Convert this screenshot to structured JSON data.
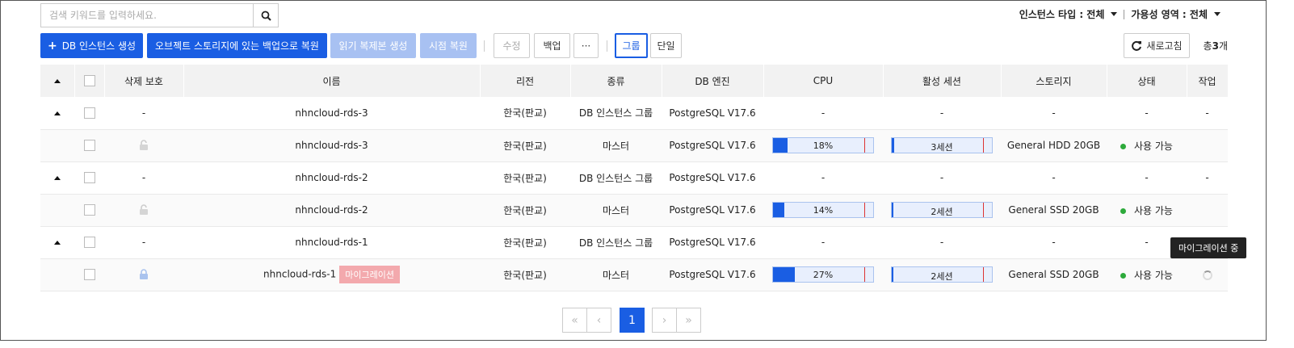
{
  "search": {
    "placeholder": "검색 키워드를 입력하세요."
  },
  "filters": {
    "instance_type": "인스턴스 타입 : 전체",
    "availability_zone": "가용성 영역 : 전체"
  },
  "toolbar": {
    "create_label": "DB 인스턴스 생성",
    "restore_object_label": "오브젝트 스토리지에 있는 백업으로 복원",
    "read_replica_label": "읽기 복제본 생성",
    "pitr_label": "시점 복원",
    "edit_label": "수정",
    "backup_label": "백업",
    "more_label": "···",
    "group_label": "그룹",
    "single_label": "단일",
    "refresh_label": "새로고침",
    "total_prefix": "총",
    "total_count": "3",
    "total_suffix": "개"
  },
  "table": {
    "headers": [
      "삭제 보호",
      "이름",
      "리전",
      "종류",
      "DB 엔진",
      "CPU",
      "활성 세션",
      "스토리지",
      "상태",
      "작업"
    ],
    "rows": [
      {
        "kind": "group",
        "protect": "-",
        "name": "nhncloud-rds-3",
        "region": "한국(판교)",
        "type": "DB 인스턴스 그룹",
        "engine": "PostgreSQL V17.6",
        "cpu": "-",
        "sessions": "-",
        "storage": "-",
        "status": "-",
        "action": "-"
      },
      {
        "kind": "child",
        "name": "nhncloud-rds-3",
        "region": "한국(판교)",
        "type": "마스터",
        "engine": "PostgreSQL V17.6",
        "cpu": "18%",
        "cpu_value": 18,
        "sessions": "3세션",
        "sessions_fill": 2,
        "storage": "General HDD 20GB",
        "status": "사용 가능"
      },
      {
        "kind": "group",
        "protect": "-",
        "name": "nhncloud-rds-2",
        "region": "한국(판교)",
        "type": "DB 인스턴스 그룹",
        "engine": "PostgreSQL V17.6",
        "cpu": "-",
        "sessions": "-",
        "storage": "-",
        "status": "-",
        "action": "-"
      },
      {
        "kind": "child",
        "name": "nhncloud-rds-2",
        "region": "한국(판교)",
        "type": "마스터",
        "engine": "PostgreSQL V17.6",
        "cpu": "14%",
        "cpu_value": 14,
        "sessions": "2세션",
        "sessions_fill": 1,
        "storage": "General SSD 20GB",
        "status": "사용 가능"
      },
      {
        "kind": "group",
        "protect": "-",
        "name": "nhncloud-rds-1",
        "region": "한국(판교)",
        "type": "DB 인스턴스 그룹",
        "engine": "PostgreSQL V17.6",
        "cpu": "-",
        "sessions": "-",
        "storage": "-",
        "status": "-"
      },
      {
        "kind": "child",
        "name": "nhncloud-rds-1",
        "badge": "마이그레이션",
        "region": "한국(판교)",
        "type": "마스터",
        "engine": "PostgreSQL V17.6",
        "cpu": "27%",
        "cpu_value": 27,
        "sessions": "2세션",
        "sessions_fill": 1,
        "storage": "General SSD 20GB",
        "status": "사용 가능"
      }
    ]
  },
  "tooltip": {
    "text": "마이그레이션 중"
  },
  "pagination": {
    "current": "1"
  },
  "colors": {
    "accent": "#1a5ee3",
    "status_ok": "#2daa3b",
    "badge": "#f3a9ad"
  }
}
